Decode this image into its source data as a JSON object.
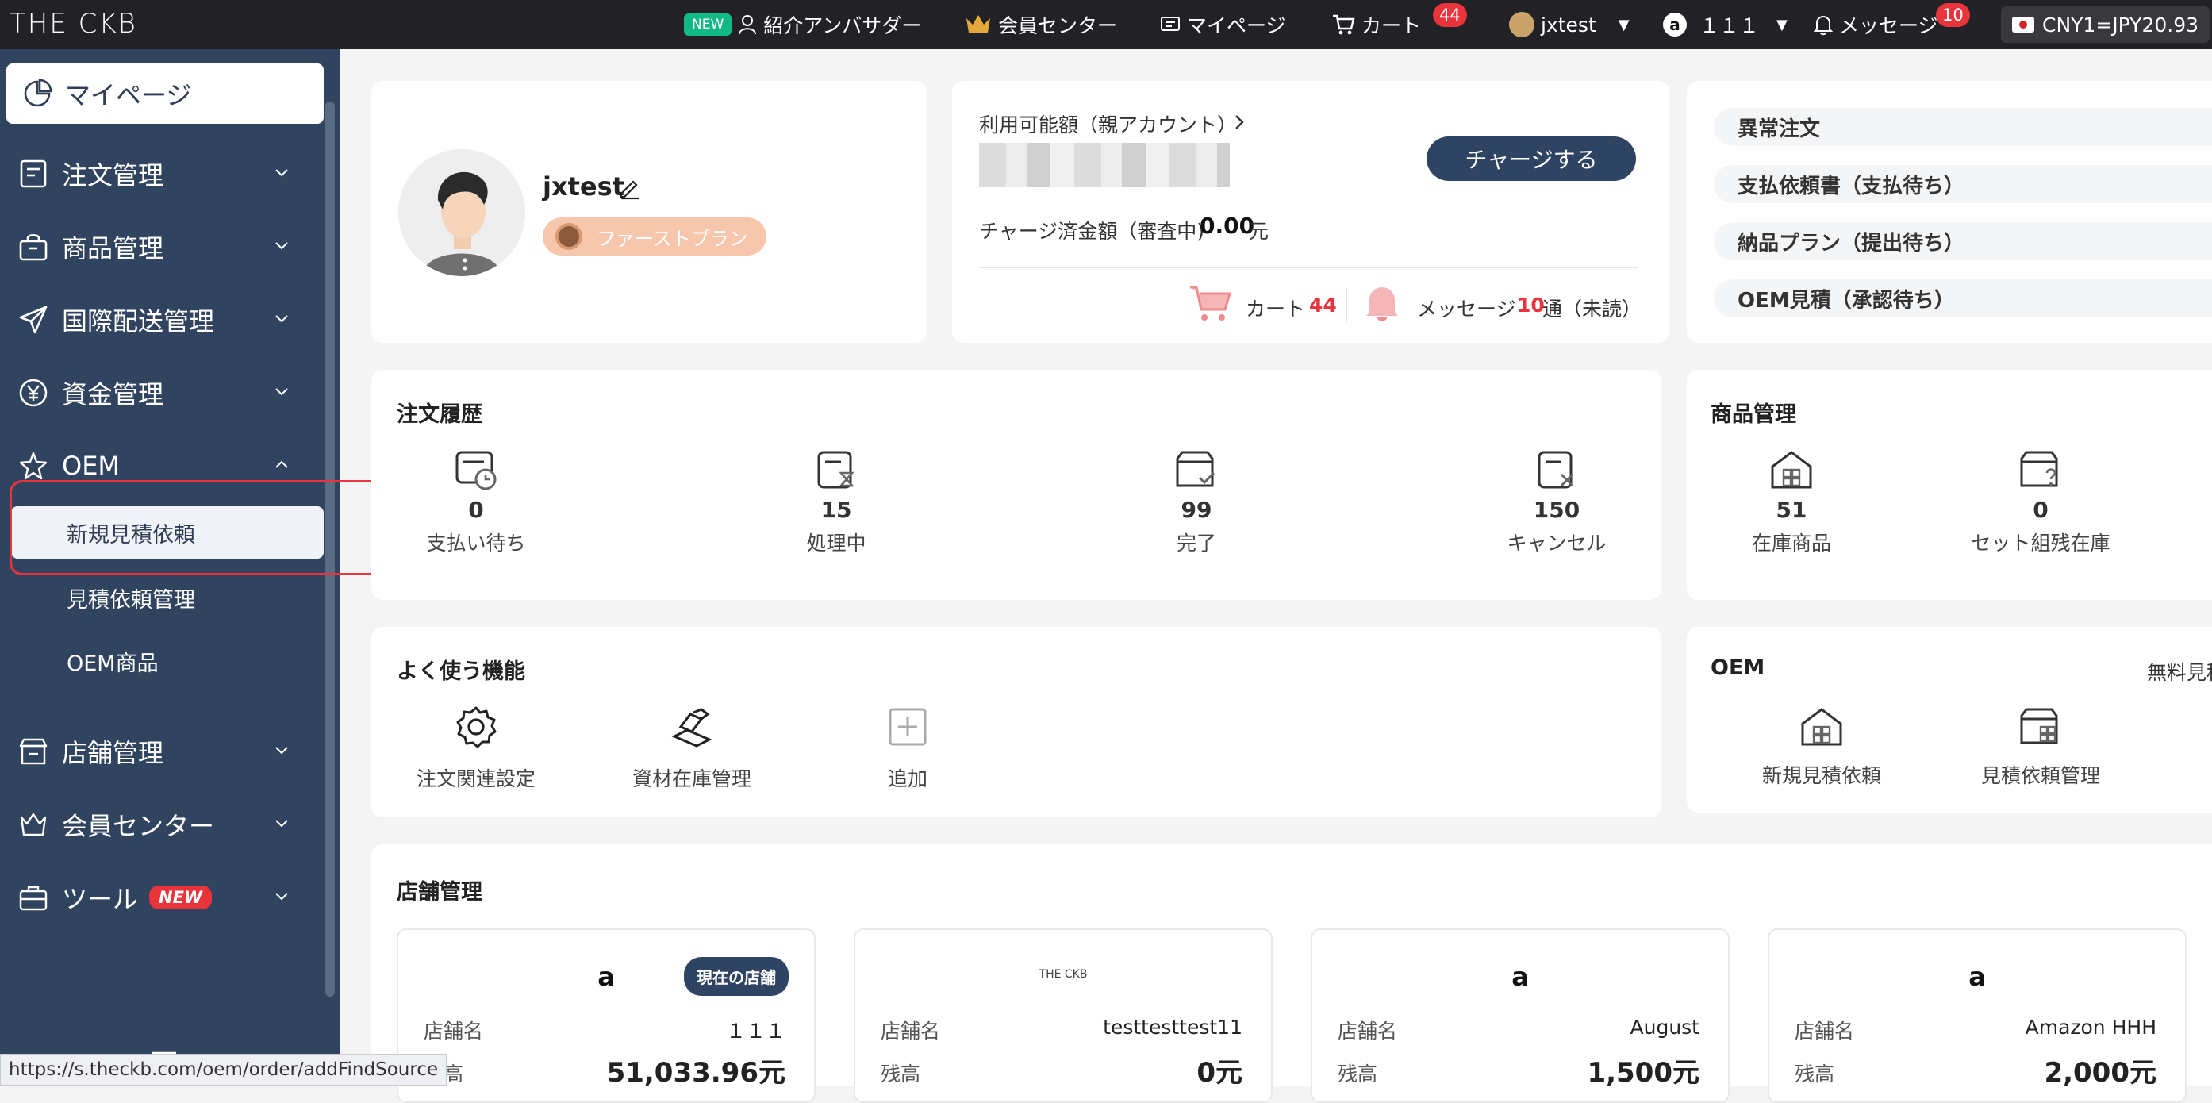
{
  "topbar": {
    "logo": "THE CKB",
    "new_tag": "NEW",
    "ambassador": "紹介アンバサダー",
    "member_center": "会員センター",
    "mypage": "マイページ",
    "cart": "カート",
    "cart_count": "44",
    "user": "jxtest",
    "shop": "１１１",
    "messages": "メッセージ",
    "messages_count": "10",
    "currency": "CNY1=JPY20.93"
  },
  "sidebar": {
    "active": "マイページ",
    "items": [
      {
        "label": "注文管理"
      },
      {
        "label": "商品管理"
      },
      {
        "label": "国際配送管理"
      },
      {
        "label": "資金管理"
      },
      {
        "label": "OEM"
      },
      {
        "label": "店舗管理"
      },
      {
        "label": "会員センター"
      },
      {
        "label": "ツール"
      }
    ],
    "oem_sub": [
      "新規見積依頼",
      "見積依頼管理",
      "OEM商品"
    ],
    "tool_new": "NEW"
  },
  "status_url": "https://s.theckb.com/oem/order/addFindSource",
  "profile": {
    "username": "jxtest",
    "plan": "ファーストプラン"
  },
  "funds": {
    "available_label": "利用可能額（親アカウント）",
    "charge_button": "チャージする",
    "pending_label": "チャージ済金額（審査中)",
    "pending_value": "0.00",
    "pending_unit": "元",
    "cart_label": "カート",
    "cart_count": "44",
    "msg_label": "メッセージ",
    "msg_count": "10",
    "msg_suffix": "通（未読）"
  },
  "alerts": [
    "異常注文",
    "支払依頼書（支払待ち）",
    "納品プラン（提出待ち）",
    "OEM見積（承認待ち）"
  ],
  "orders": {
    "title": "注文履歴",
    "stats": [
      {
        "value": "0",
        "label": "支払い待ち"
      },
      {
        "value": "15",
        "label": "処理中"
      },
      {
        "value": "99",
        "label": "完了"
      },
      {
        "value": "150",
        "label": "キャンセル"
      }
    ]
  },
  "products": {
    "title": "商品管理",
    "stats": [
      {
        "value": "51",
        "label": "在庫商品"
      },
      {
        "value": "0",
        "label": "セット組残在庫"
      }
    ]
  },
  "frequent": {
    "title": "よく使う機能",
    "items": [
      "注文関連設定",
      "資材在庫管理",
      "追加"
    ]
  },
  "oem_card": {
    "title": "OEM",
    "right_label": "無料見積",
    "items": [
      "新規見積依頼",
      "見積依頼管理"
    ]
  },
  "stores": {
    "title": "店舗管理",
    "name_label": "店舗名",
    "balance_label": "残高",
    "current_badge": "現在の店舗",
    "list": [
      {
        "logo": "a",
        "name": "１１１",
        "balance": "51,033.96元"
      },
      {
        "logo": "THE CKB",
        "name": "testtesttest11",
        "balance": "0元"
      },
      {
        "logo": "a",
        "name": "August",
        "balance": "1,500元"
      },
      {
        "logo": "a",
        "name": "Amazon HHH",
        "balance": "2,000元"
      }
    ]
  },
  "colors": {
    "navy": "#30435f",
    "accent_red": "#e8343a",
    "button": "#2f4363"
  }
}
